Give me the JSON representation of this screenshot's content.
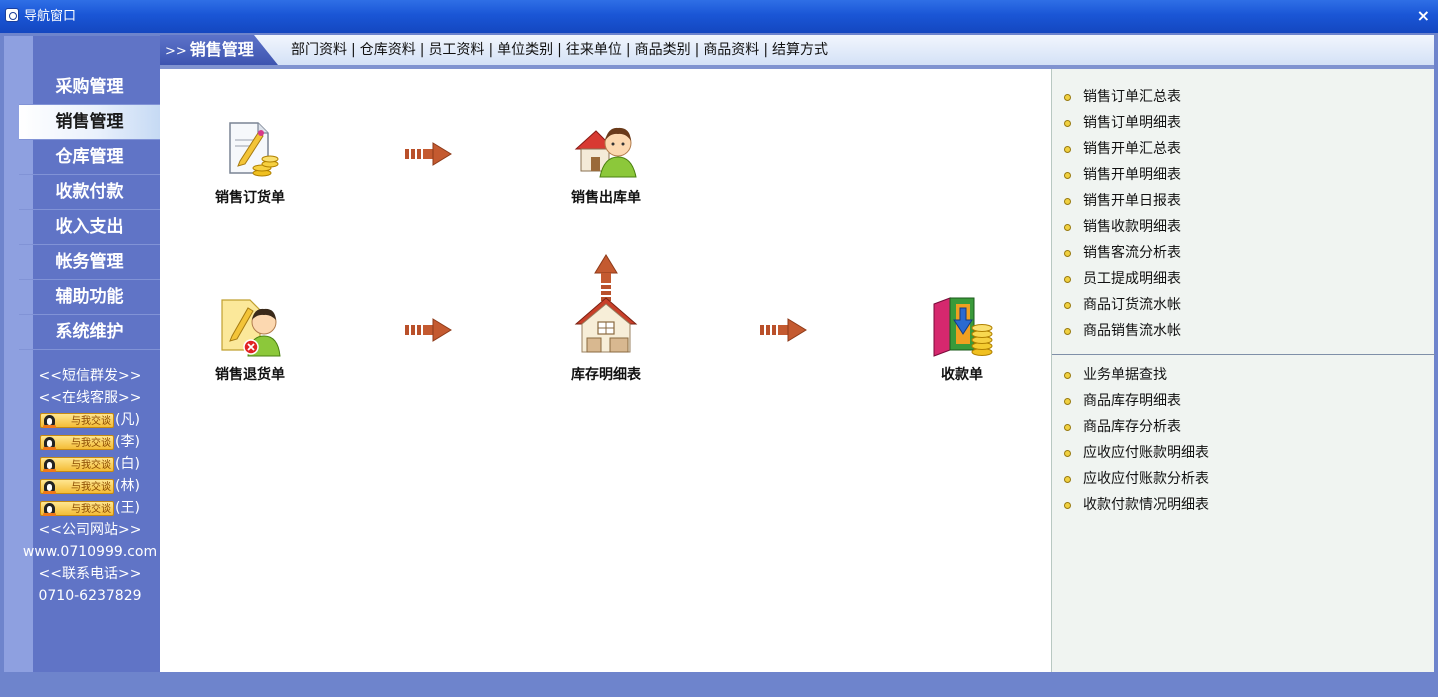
{
  "window": {
    "title": "导航窗口",
    "close": "×"
  },
  "sidebar": {
    "items": [
      {
        "label": "采购管理"
      },
      {
        "label": "销售管理",
        "active": true
      },
      {
        "label": "仓库管理"
      },
      {
        "label": "收款付款"
      },
      {
        "label": "收入支出"
      },
      {
        "label": "帐务管理"
      },
      {
        "label": "辅助功能"
      },
      {
        "label": "系统维护"
      }
    ],
    "sms": "<<短信群发>>",
    "online_service": "<<在线客服>>",
    "chat_button": "与我交谈",
    "staff": [
      "(凡)",
      "(李)",
      "(白)",
      "(林)",
      "(王)"
    ],
    "website_label": "<<公司网站>>",
    "website": "www.0710999.com",
    "phone_label": "<<联系电话>>",
    "phone": "0710-6237829"
  },
  "tabs": {
    "active_prefix": ">>",
    "active": "销售管理",
    "links": [
      "部门资料",
      "仓库资料",
      "员工资料",
      "单位类别",
      "往来单位",
      "商品类别",
      "商品资料",
      "结算方式"
    ]
  },
  "flow": {
    "sales_order": "销售订货单",
    "sales_outbound": "销售出库单",
    "sales_return": "销售退货单",
    "inventory_detail": "库存明细表",
    "receipt": "收款单"
  },
  "reports": {
    "group1": [
      "销售订单汇总表",
      "销售订单明细表",
      "销售开单汇总表",
      "销售开单明细表",
      "销售开单日报表",
      "销售收款明细表",
      "销售客流分析表",
      "员工提成明细表",
      "商品订货流水帐",
      "商品销售流水帐"
    ],
    "group2": [
      "业务单据查找",
      "商品库存明细表",
      "商品库存分析表",
      "应收应付账款明细表",
      "应收应付账款分析表",
      "收款付款情况明细表"
    ]
  }
}
